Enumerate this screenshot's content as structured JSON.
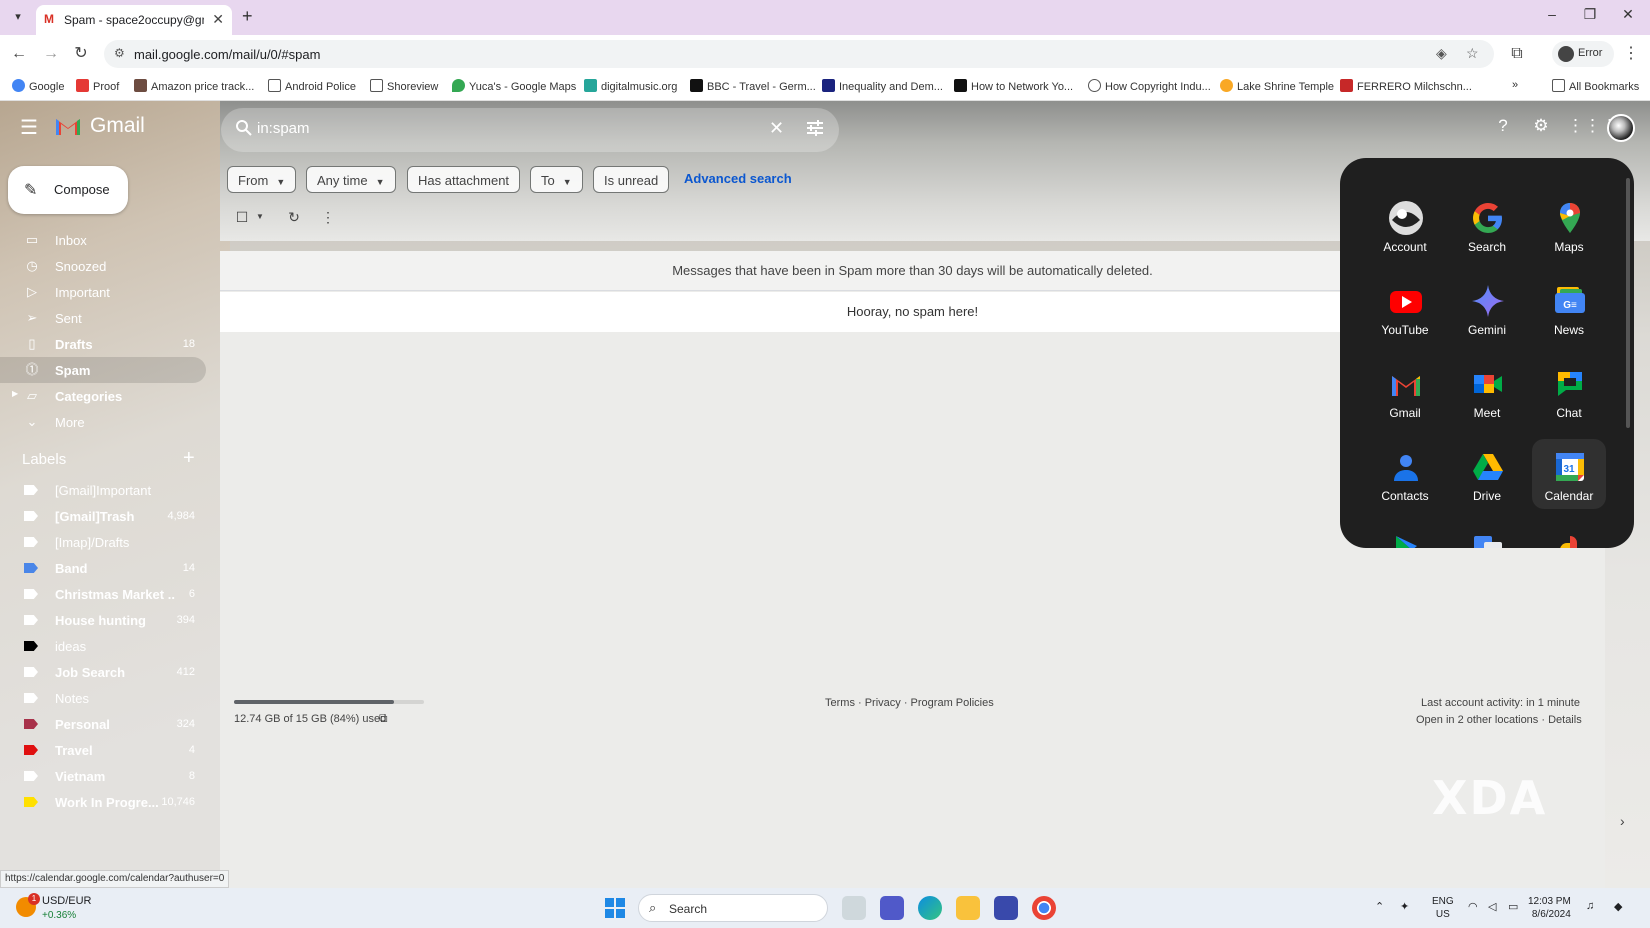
{
  "browser": {
    "tab_title": "Spam - space2occupy@gmail.com",
    "url": "mail.google.com/mail/u/0/#spam",
    "profile_status": "Error",
    "bookmarks": [
      "Google",
      "Proof",
      "Amazon price track...",
      "Android Police",
      "Shoreview",
      "Yuca's - Google Maps",
      "digitalmusic.org",
      "BBC - Travel - Germ...",
      "Inequality and Dem...",
      "How to Network Yo...",
      "How Copyright Indu...",
      "Lake Shrine Temple",
      "FERRERO Milchschn..."
    ],
    "all_bookmarks": "All Bookmarks",
    "status_url": "https://calendar.google.com/calendar?authuser=0"
  },
  "gmail": {
    "brand": "Gmail",
    "search_query": "in:spam",
    "compose": "Compose",
    "nav": [
      {
        "label": "Inbox",
        "count": "",
        "icon": "inbox-icon"
      },
      {
        "label": "Snoozed",
        "count": "",
        "icon": "clock-icon"
      },
      {
        "label": "Important",
        "count": "",
        "icon": "important-icon"
      },
      {
        "label": "Sent",
        "count": "",
        "icon": "send-icon"
      },
      {
        "label": "Drafts",
        "count": "18",
        "icon": "draft-icon"
      },
      {
        "label": "Spam",
        "count": "",
        "icon": "spam-icon"
      },
      {
        "label": "Categories",
        "count": "",
        "icon": "label-icon"
      },
      {
        "label": "More",
        "count": "",
        "icon": "chevron-down-icon"
      }
    ],
    "labels_title": "Labels",
    "labels": [
      {
        "name": "[Gmail]Important",
        "count": "",
        "color": "#ffffff",
        "bold": false
      },
      {
        "name": "[Gmail]Trash",
        "count": "4,984",
        "color": "#ffffff",
        "bold": true
      },
      {
        "name": "[Imap]/Drafts",
        "count": "",
        "color": "#ffffff",
        "bold": false
      },
      {
        "name": "Band",
        "count": "14",
        "color": "#4a86e8",
        "bold": true
      },
      {
        "name": "Christmas Market ...",
        "count": "6",
        "color": "#ffffff",
        "bold": true
      },
      {
        "name": "House hunting",
        "count": "394",
        "color": "#ffffff",
        "bold": true
      },
      {
        "name": "ideas",
        "count": "",
        "color": "#000000",
        "bold": false
      },
      {
        "name": "Job Search",
        "count": "412",
        "color": "#ffffff",
        "bold": true
      },
      {
        "name": "Notes",
        "count": "",
        "color": "#ffffff",
        "bold": false
      },
      {
        "name": "Personal",
        "count": "324",
        "color": "#a8324a",
        "bold": true
      },
      {
        "name": "Travel",
        "count": "4",
        "color": "#e01010",
        "bold": true
      },
      {
        "name": "Vietnam",
        "count": "8",
        "color": "#ffffff",
        "bold": true
      },
      {
        "name": "Work In Progre...",
        "count": "10,746",
        "color": "#ffe000",
        "bold": true
      }
    ],
    "filters": {
      "from": "From",
      "any_time": "Any time",
      "has_attachment": "Has attachment",
      "to": "To",
      "is_unread": "Is unread",
      "advanced": "Advanced search"
    },
    "banner": "Messages that have been in Spam more than 30 days will be automatically deleted.",
    "empty": "Hooray, no spam here!",
    "storage": {
      "text": "12.74 GB of 15 GB (84%) used",
      "fraction": 0.84
    },
    "footer_links": "Terms · Privacy · Program Policies",
    "activity": "Last account activity: in 1 minute",
    "activity2": "Open in 2 other locations · Details"
  },
  "apps": [
    {
      "label": "Account",
      "icon": "account-icon"
    },
    {
      "label": "Search",
      "icon": "google-search-icon"
    },
    {
      "label": "Maps",
      "icon": "maps-icon"
    },
    {
      "label": "YouTube",
      "icon": "youtube-icon"
    },
    {
      "label": "Gemini",
      "icon": "gemini-icon"
    },
    {
      "label": "News",
      "icon": "news-icon"
    },
    {
      "label": "Gmail",
      "icon": "gmail-icon"
    },
    {
      "label": "Meet",
      "icon": "meet-icon"
    },
    {
      "label": "Chat",
      "icon": "chat-icon"
    },
    {
      "label": "Contacts",
      "icon": "contacts-icon"
    },
    {
      "label": "Drive",
      "icon": "drive-icon"
    },
    {
      "label": "Calendar",
      "icon": "calendar-icon"
    }
  ],
  "watermark": "XDA",
  "taskbar": {
    "ticker_name": "USD/EUR",
    "ticker_change": "+0.36%",
    "ticker_badge": "1",
    "search": "Search",
    "lang1": "ENG",
    "lang2": "US",
    "time": "12:03 PM",
    "date": "8/6/2024"
  },
  "colors": {
    "accent_link": "#0b57d0",
    "apps_bg": "#1f1f1f"
  }
}
